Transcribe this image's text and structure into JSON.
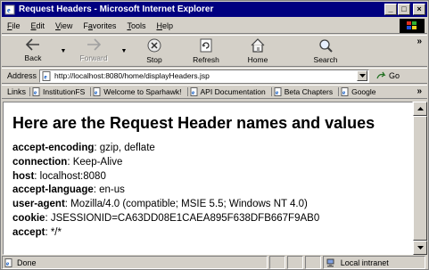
{
  "window": {
    "title": "Request Headers - Microsoft Internet Explorer"
  },
  "menu": [
    {
      "label": "File",
      "key": "F",
      "rest": "ile"
    },
    {
      "label": "Edit",
      "key": "E",
      "rest": "dit"
    },
    {
      "label": "View",
      "key": "V",
      "rest": "iew"
    },
    {
      "label": "Favorites",
      "key": "a",
      "pre": "F",
      "rest": "vorites"
    },
    {
      "label": "Tools",
      "key": "T",
      "rest": "ools"
    },
    {
      "label": "Help",
      "key": "H",
      "rest": "elp"
    }
  ],
  "toolbar": {
    "back": "Back",
    "forward": "Forward",
    "stop": "Stop",
    "refresh": "Refresh",
    "home": "Home",
    "search": "Search"
  },
  "address": {
    "label": "Address",
    "url": "http://localhost:8080/home/displayHeaders.jsp",
    "go": "Go"
  },
  "links": {
    "label": "Links",
    "items": [
      "InstitutionFS",
      "Welcome to Sparhawk!",
      "API Documentation",
      "Beta Chapters",
      "Google"
    ]
  },
  "page": {
    "heading": "Here are the Request Header names and values",
    "headers": [
      {
        "name": "accept-encoding",
        "value": ": gzip, deflate"
      },
      {
        "name": "connection",
        "value": ": Keep-Alive"
      },
      {
        "name": "host",
        "value": ": localhost:8080"
      },
      {
        "name": "accept-language",
        "value": ": en-us"
      },
      {
        "name": "user-agent",
        "value": ": Mozilla/4.0 (compatible; MSIE 5.5; Windows NT 4.0)"
      },
      {
        "name": "cookie",
        "value": ": JSESSIONID=CA63DD08E1CAEA895F638DFB667F9AB0"
      },
      {
        "name": "accept",
        "value": ": */*"
      }
    ]
  },
  "status": {
    "text": "Done",
    "zone": "Local intranet"
  },
  "colors": {
    "titlebar": "#000080",
    "chrome": "#d4d0c8"
  }
}
